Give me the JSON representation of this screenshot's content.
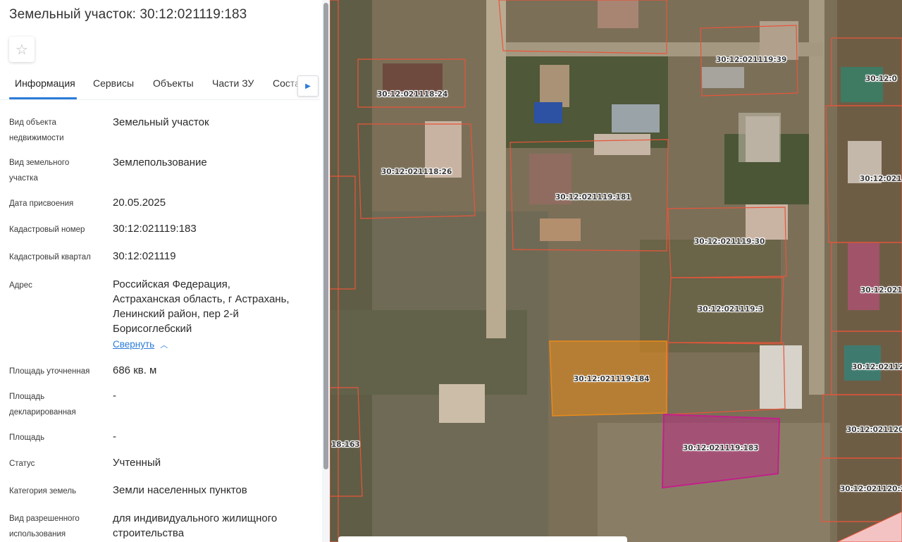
{
  "title": "Земельный участок: 30:12:021119:183",
  "favorite_icon": "star-outline-icon",
  "tabs": [
    {
      "label": "Информация",
      "active": true
    },
    {
      "label": "Сервисы"
    },
    {
      "label": "Объекты"
    },
    {
      "label": "Части ЗУ"
    },
    {
      "label": "Соста"
    }
  ],
  "tabs_next_icon": "chevron-right-icon",
  "fields": {
    "object_type": {
      "label_l1": "Вид объекта",
      "label_l2": "недвижимости",
      "value": "Земельный участок"
    },
    "land_type": {
      "label_l1": "Вид земельного",
      "label_l2": "участка",
      "value": "Землепользование"
    },
    "assign_date": {
      "label": "Дата присвоения",
      "value": "20.05.2025"
    },
    "cadastral_number": {
      "label": "Кадастровый номер",
      "value": "30:12:021119:183"
    },
    "cadastral_quarter": {
      "label": "Кадастровый квартал",
      "value": "30:12:021119"
    },
    "address": {
      "label": "Адрес",
      "lines": [
        "Российская Федерация,",
        "Астраханская область, г Астрахань,",
        "Ленинский район, пер 2-й",
        "Борисоглебский"
      ],
      "collapse_label": "Свернуть"
    },
    "area_refined": {
      "label": "Площадь уточненная",
      "value": "686 кв. м"
    },
    "area_declared": {
      "label_l1": "Площадь",
      "label_l2": "декларированная",
      "value": "-"
    },
    "area": {
      "label": "Площадь",
      "value": "-"
    },
    "status": {
      "label": "Статус",
      "value": "Учтенный"
    },
    "land_category": {
      "label": "Категория земель",
      "value": "Земли населенных пунктов"
    },
    "permitted_use": {
      "label_l1": "Вид разрешенного",
      "label_l2": "использования",
      "value_l1": "для индивидуального жилищного",
      "value_l2": "строительства"
    }
  },
  "map": {
    "parcel_border_color": "#e8553a",
    "selected_parcel_color": "#c2208a",
    "highlight_parcel_color": "#e88a1a",
    "labels": [
      "30:12:021119:39",
      "30:12:021118:24",
      "30:12:021118:26",
      "30:12:021119:181",
      "30:12:021119:30",
      "30:12:021119:3",
      "30:12:021119:184",
      "30:12:021119:183",
      "18:163",
      "30:12:0",
      "30:12:021",
      "30:12:0211",
      "30:12:02112",
      "30:12:021120:",
      "30:12:021120:2"
    ]
  }
}
